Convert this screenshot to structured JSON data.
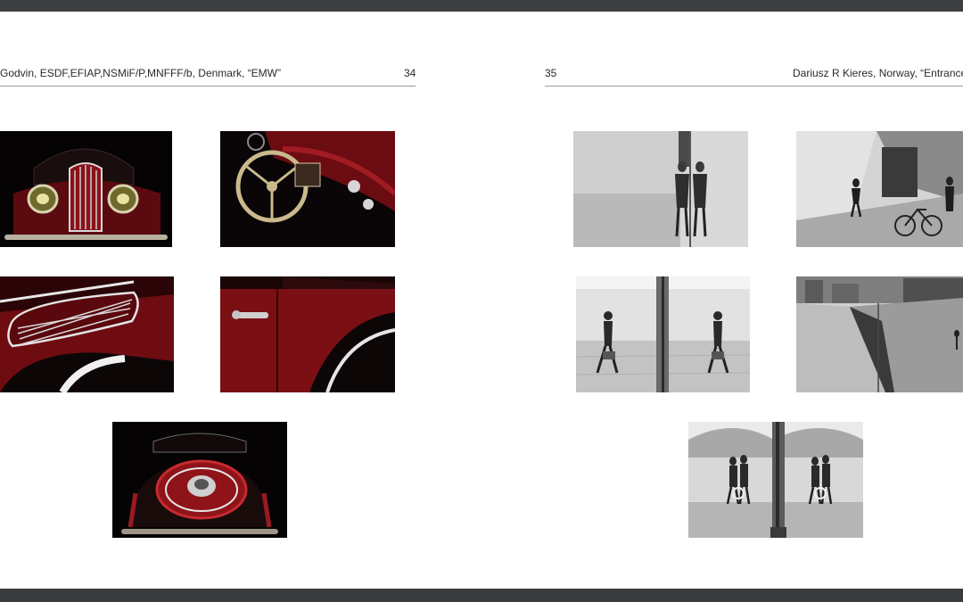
{
  "left_page": {
    "header": "Godvin, ESDF,EFIAP,NSMiF/P,MNFFF/b, Denmark, “EMW”",
    "page_number": "34",
    "photos": [
      {
        "subject": "car-front-grille"
      },
      {
        "subject": "car-dashboard-steering-wheel"
      },
      {
        "subject": "car-side-vent"
      },
      {
        "subject": "car-door-handle"
      },
      {
        "subject": "car-rear-spare-wheel"
      }
    ]
  },
  "right_page": {
    "page_number": "35",
    "header": "Dariusz R Kieres, Norway, “Entrance s",
    "photos": [
      {
        "subject": "woman-mirror-reflection"
      },
      {
        "subject": "person-with-bicycles"
      },
      {
        "subject": "walker-mirror-reflection"
      },
      {
        "subject": "building-mirror-facade"
      },
      {
        "subject": "group-mirror-reflection"
      }
    ]
  },
  "colors": {
    "frame": "#3c3d3f",
    "page": "#ffffff",
    "text": "#2b2b2b",
    "rule": "#9a9a9a",
    "car_red": "#7a0f14"
  }
}
